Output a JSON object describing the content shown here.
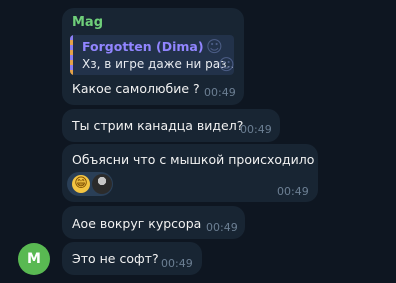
{
  "messages": [
    {
      "sender": "Mag",
      "reply": {
        "name": "Forgotten (Dima)",
        "text": "Хз, в игре даже ни раз..."
      },
      "text": "Какое самолюбие ?",
      "time": "00:49"
    },
    {
      "text": "Ты стрим канадца видел?",
      "time": "00:49"
    },
    {
      "text": "Объясни что с мышкой происходило",
      "time": "00:49",
      "reaction": {
        "emoji": "😁",
        "icon": "user-avatar"
      }
    },
    {
      "text": "Аое вокруг курсора",
      "time": "00:49"
    },
    {
      "text": "Это не софт?",
      "time": "00:49"
    }
  ],
  "avatar": {
    "initial": "M",
    "color": "#59b952"
  },
  "colors": {
    "background": "#0e1621",
    "bubble": "#182533",
    "sender": "#6fcf7a",
    "reply_name": "#9185ff",
    "time": "#6c7f93"
  }
}
